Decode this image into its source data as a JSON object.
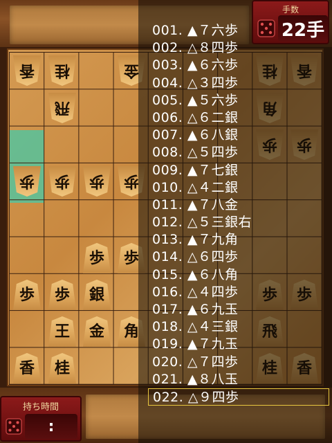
{
  "header": {
    "counter_label": "手数",
    "counter_value": "22手"
  },
  "footer": {
    "timer_label": "持ち時間",
    "timer_value": ":"
  },
  "board": {
    "pieces": [
      {
        "label": "香",
        "side": "gote"
      },
      {
        "label": "桂",
        "side": "gote"
      },
      {
        "label": "金",
        "side": "gote"
      },
      {
        "label": "香",
        "side": "gote"
      },
      {
        "label": "桂",
        "side": "gote"
      },
      {
        "label": "飛",
        "side": "gote"
      },
      {
        "label": "角",
        "side": "gote"
      },
      {
        "label": "歩",
        "side": "gote"
      },
      {
        "label": "歩",
        "side": "gote"
      },
      {
        "label": "歩",
        "side": "gote"
      },
      {
        "label": "歩",
        "side": "gote"
      },
      {
        "label": "歩",
        "side": "gote"
      },
      {
        "label": "歩",
        "side": "gote"
      },
      {
        "label": "歩",
        "side": "sente"
      },
      {
        "label": "歩",
        "side": "sente"
      },
      {
        "label": "歩",
        "side": "sente"
      },
      {
        "label": "歩",
        "side": "sente"
      },
      {
        "label": "銀",
        "side": "sente"
      },
      {
        "label": "歩",
        "side": "sente"
      },
      {
        "label": "歩",
        "side": "sente"
      },
      {
        "label": "王",
        "side": "sente"
      },
      {
        "label": "金",
        "side": "sente"
      },
      {
        "label": "角",
        "side": "sente"
      },
      {
        "label": "飛",
        "side": "sente"
      },
      {
        "label": "香",
        "side": "sente"
      },
      {
        "label": "桂",
        "side": "sente"
      },
      {
        "label": "桂",
        "side": "sente"
      },
      {
        "label": "香",
        "side": "sente"
      }
    ]
  },
  "moves": [
    "001. ▲７六歩",
    "002. △８四歩",
    "003. ▲６六歩",
    "004. △３四歩",
    "005. ▲５六歩",
    "006. △６二銀",
    "007. ▲６八銀",
    "008. △５四歩",
    "009. ▲７七銀",
    "010. △４二銀",
    "011. ▲７八金",
    "012. △５三銀右",
    "013. ▲７九角",
    "014. △６四歩",
    "015. ▲６八角",
    "016. △４四歩",
    "017. ▲６九玉",
    "018. △４三銀",
    "019. ▲７九玉",
    "020. △７四歩",
    "021. ▲８八玉",
    "022. △９四歩"
  ],
  "current_move_index": 21,
  "icons": {
    "counter": "dice-icon",
    "timer": "dice-icon"
  },
  "colors": {
    "highlight": "#5fbf96",
    "panel_red": "#8c1a1a",
    "current_border": "#e8c840"
  }
}
